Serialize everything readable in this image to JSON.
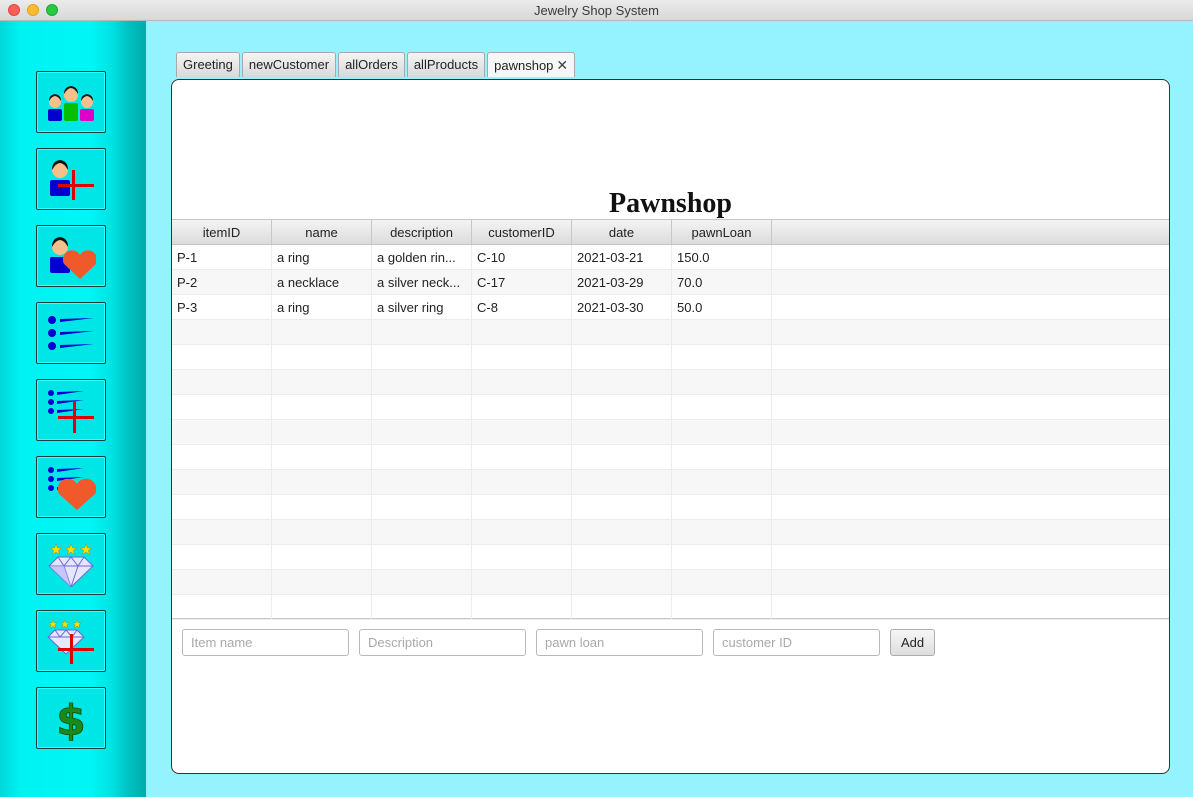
{
  "window": {
    "title": "Jewelry Shop System"
  },
  "sidebar": {
    "buttons": [
      {
        "icon": "customers-icon"
      },
      {
        "icon": "add-customer-icon"
      },
      {
        "icon": "favorite-customer-icon"
      },
      {
        "icon": "orders-list-icon"
      },
      {
        "icon": "add-order-icon"
      },
      {
        "icon": "favorite-orders-icon"
      },
      {
        "icon": "diamond-products-icon"
      },
      {
        "icon": "add-product-icon"
      },
      {
        "icon": "dollar-icon"
      }
    ]
  },
  "tabs": [
    {
      "label": "Greeting"
    },
    {
      "label": "newCustomer"
    },
    {
      "label": "allOrders"
    },
    {
      "label": "allProducts"
    },
    {
      "label": "pawnshop",
      "close": "✕",
      "active": true
    }
  ],
  "panel": {
    "title": "Pawnshop"
  },
  "table": {
    "columns": [
      "itemID",
      "name",
      "description",
      "customerID",
      "date",
      "pawnLoan"
    ],
    "rows": [
      [
        "P-1",
        "a ring",
        "a golden rin...",
        "C-10",
        "2021-03-21",
        "150.0"
      ],
      [
        "P-2",
        "a necklace",
        "a silver neck...",
        "C-17",
        "2021-03-29",
        "70.0"
      ],
      [
        "P-3",
        "a ring",
        "a silver ring",
        "C-8",
        "2021-03-30",
        "50.0"
      ]
    ]
  },
  "form": {
    "item_name_placeholder": "Item name",
    "description_placeholder": "Description",
    "pawn_loan_placeholder": "pawn loan",
    "customer_id_placeholder": "customer ID",
    "add_label": "Add"
  },
  "colors": {
    "sidebar": "#00f0f0",
    "content_background": "#95f3ff",
    "heart": "#f05a2a",
    "cross": "#e00000",
    "list_blue": "#0000e0",
    "dollar": "#1a8a1a"
  }
}
